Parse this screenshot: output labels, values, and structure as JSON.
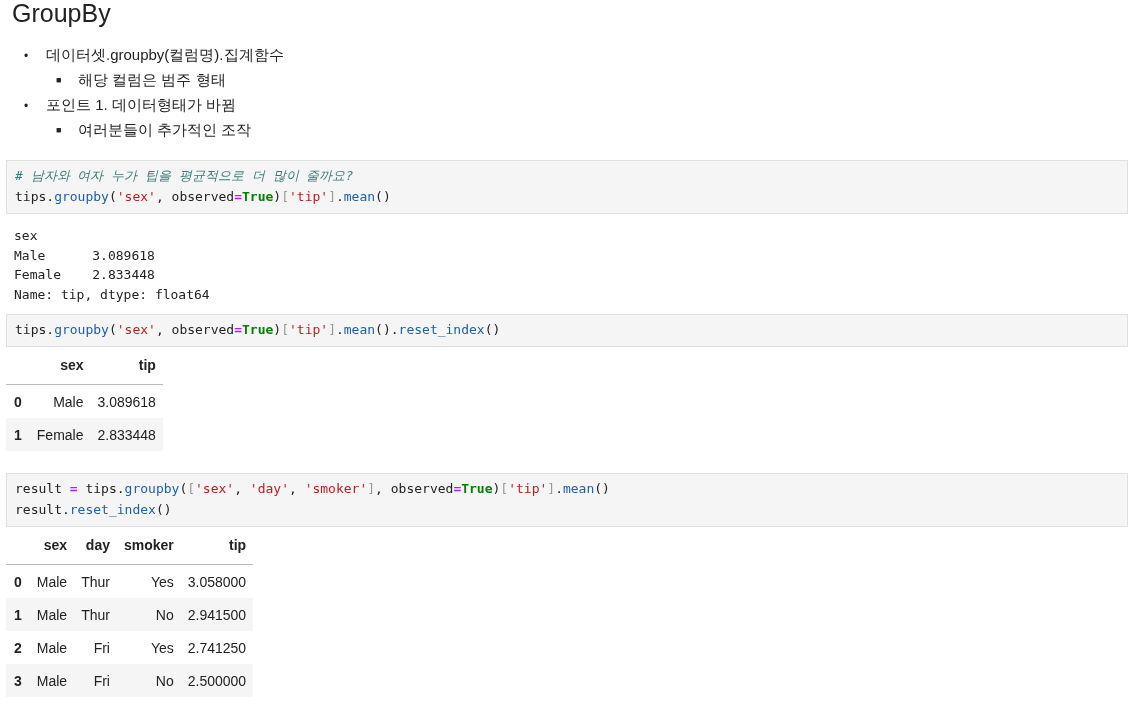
{
  "heading": "GroupBy",
  "bullets": [
    {
      "marker": "•",
      "text": "데이터셋.groupby(컬럼명).집계함수",
      "children": [
        {
          "marker": "■",
          "text": "해당 컬럼은 범주 형태"
        }
      ]
    },
    {
      "marker": "•",
      "text": "포인트 1. 데이터형태가 바뀜",
      "children": [
        {
          "marker": "■",
          "text": "여러분들이 추가적인 조작"
        }
      ]
    }
  ],
  "cells": [
    {
      "kind": "code",
      "lines": [
        [
          {
            "text": "# 남자와 여자 누가 팁을 평균적으로 더 많이 줄까요?",
            "kind": "comment"
          }
        ],
        [
          {
            "text": "tips.",
            "kind": "plain"
          },
          {
            "text": "groupby",
            "kind": "func"
          },
          {
            "text": "(",
            "kind": "plain"
          },
          {
            "text": "'sex'",
            "kind": "string"
          },
          {
            "text": ", observed",
            "kind": "plain"
          },
          {
            "text": "=",
            "kind": "operator"
          },
          {
            "text": "True",
            "kind": "keyword"
          },
          {
            "text": ")",
            "kind": "plain"
          },
          {
            "text": "[",
            "kind": "bracket"
          },
          {
            "text": "'tip'",
            "kind": "string"
          },
          {
            "text": "]",
            "kind": "bracket"
          },
          {
            "text": ".",
            "kind": "plain"
          },
          {
            "text": "mean",
            "kind": "func"
          },
          {
            "text": "()",
            "kind": "plain"
          }
        ]
      ]
    },
    {
      "kind": "text_output",
      "lines": [
        "sex",
        "Male      3.089618",
        "Female    2.833448",
        "Name: tip, dtype: float64"
      ]
    },
    {
      "kind": "code",
      "lines": [
        [
          {
            "text": "tips.",
            "kind": "plain"
          },
          {
            "text": "groupby",
            "kind": "func"
          },
          {
            "text": "(",
            "kind": "plain"
          },
          {
            "text": "'sex'",
            "kind": "string"
          },
          {
            "text": ", observed",
            "kind": "plain"
          },
          {
            "text": "=",
            "kind": "operator"
          },
          {
            "text": "True",
            "kind": "keyword"
          },
          {
            "text": ")",
            "kind": "plain"
          },
          {
            "text": "[",
            "kind": "bracket"
          },
          {
            "text": "'tip'",
            "kind": "string"
          },
          {
            "text": "]",
            "kind": "bracket"
          },
          {
            "text": ".",
            "kind": "plain"
          },
          {
            "text": "mean",
            "kind": "func"
          },
          {
            "text": "().",
            "kind": "plain"
          },
          {
            "text": "reset_index",
            "kind": "func"
          },
          {
            "text": "()",
            "kind": "plain"
          }
        ]
      ]
    },
    {
      "kind": "table",
      "columns": [
        "sex",
        "tip"
      ],
      "rows": [
        {
          "index": "0",
          "cells": [
            "Male",
            "3.089618"
          ]
        },
        {
          "index": "1",
          "cells": [
            "Female",
            "2.833448"
          ]
        }
      ]
    },
    {
      "kind": "code",
      "lines": [
        [
          {
            "text": "result ",
            "kind": "plain"
          },
          {
            "text": "=",
            "kind": "operator"
          },
          {
            "text": " tips.",
            "kind": "plain"
          },
          {
            "text": "groupby",
            "kind": "func"
          },
          {
            "text": "(",
            "kind": "plain"
          },
          {
            "text": "[",
            "kind": "bracket"
          },
          {
            "text": "'sex'",
            "kind": "string"
          },
          {
            "text": ", ",
            "kind": "plain"
          },
          {
            "text": "'day'",
            "kind": "string"
          },
          {
            "text": ", ",
            "kind": "plain"
          },
          {
            "text": "'smoker'",
            "kind": "string"
          },
          {
            "text": "]",
            "kind": "bracket"
          },
          {
            "text": ", observed",
            "kind": "plain"
          },
          {
            "text": "=",
            "kind": "operator"
          },
          {
            "text": "True",
            "kind": "keyword"
          },
          {
            "text": ")",
            "kind": "plain"
          },
          {
            "text": "[",
            "kind": "bracket"
          },
          {
            "text": "'tip'",
            "kind": "string"
          },
          {
            "text": "]",
            "kind": "bracket"
          },
          {
            "text": ".",
            "kind": "plain"
          },
          {
            "text": "mean",
            "kind": "func"
          },
          {
            "text": "()",
            "kind": "plain"
          }
        ],
        [
          {
            "text": "result.",
            "kind": "plain"
          },
          {
            "text": "reset_index",
            "kind": "func"
          },
          {
            "text": "()",
            "kind": "plain"
          }
        ]
      ]
    },
    {
      "kind": "table",
      "columns": [
        "sex",
        "day",
        "smoker",
        "tip"
      ],
      "rows": [
        {
          "index": "0",
          "cells": [
            "Male",
            "Thur",
            "Yes",
            "3.058000"
          ]
        },
        {
          "index": "1",
          "cells": [
            "Male",
            "Thur",
            "No",
            "2.941500"
          ]
        },
        {
          "index": "2",
          "cells": [
            "Male",
            "Fri",
            "Yes",
            "2.741250"
          ]
        },
        {
          "index": "3",
          "cells": [
            "Male",
            "Fri",
            "No",
            "2.500000"
          ]
        }
      ]
    }
  ]
}
